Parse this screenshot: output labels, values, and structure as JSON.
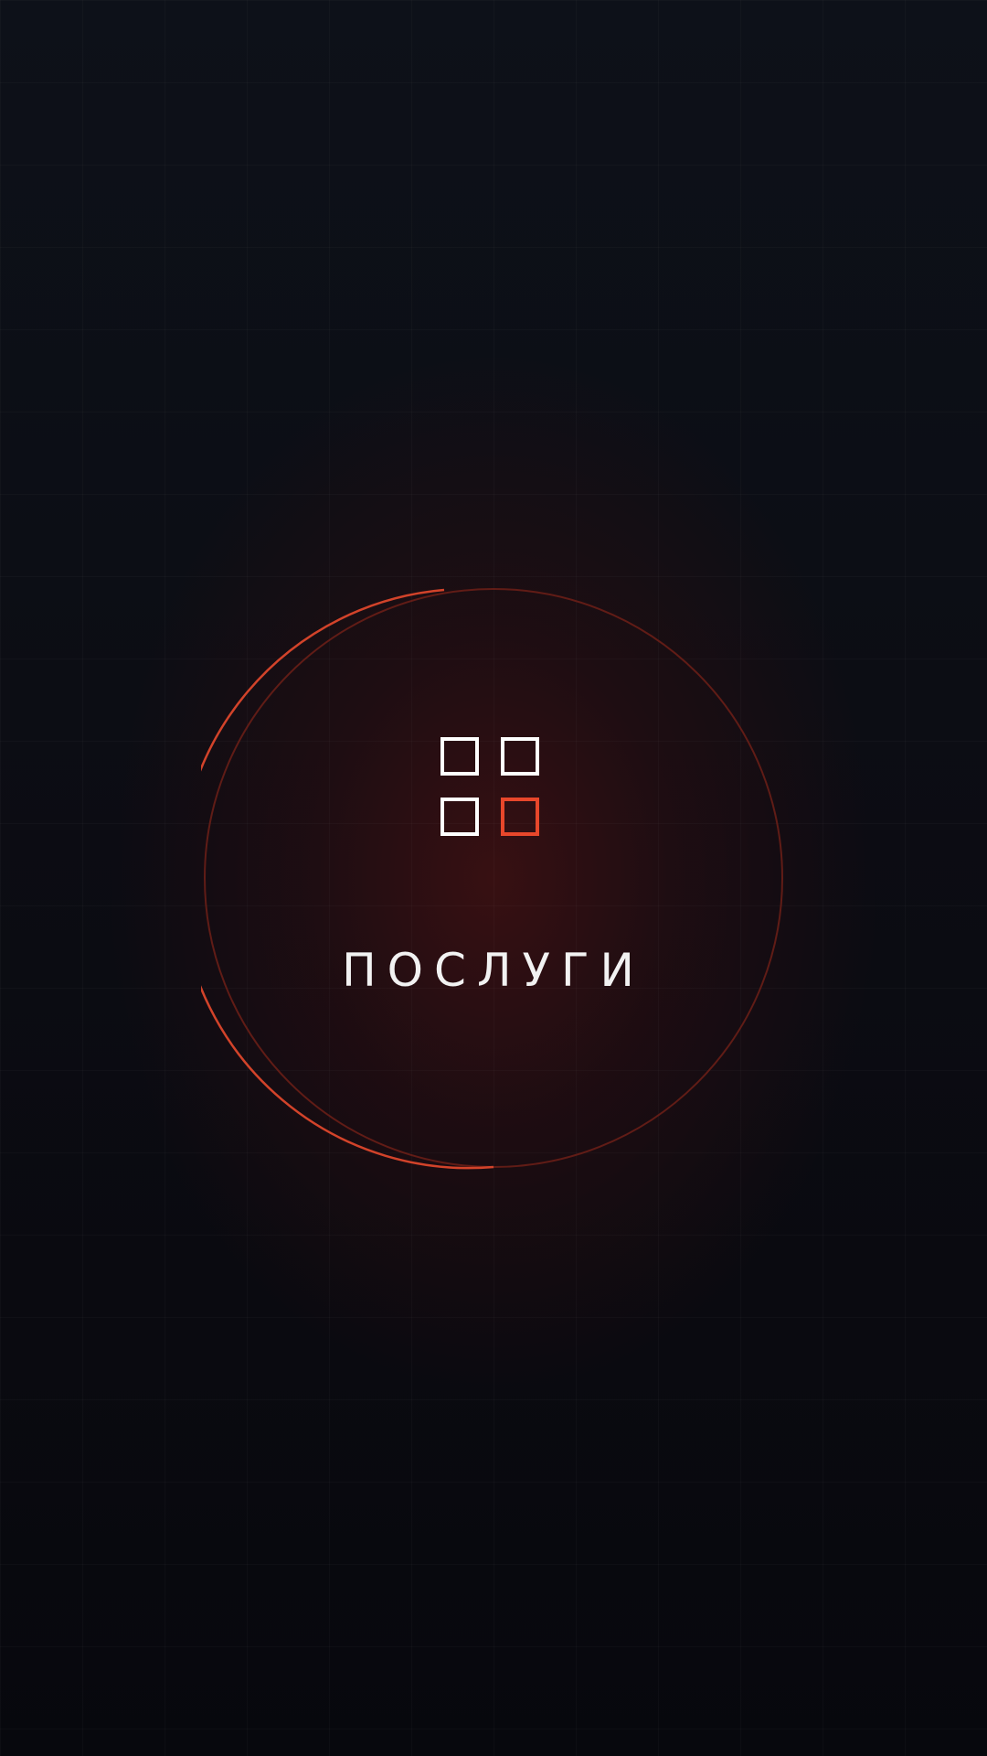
{
  "screen": {
    "title": "ПОСЛУГИ",
    "icon": "grid-four-squares-icon"
  },
  "colors": {
    "accent": "#e8472b",
    "ring": "#9c2a1e",
    "text": "#f2f2f2",
    "background": "#0b0d13"
  }
}
